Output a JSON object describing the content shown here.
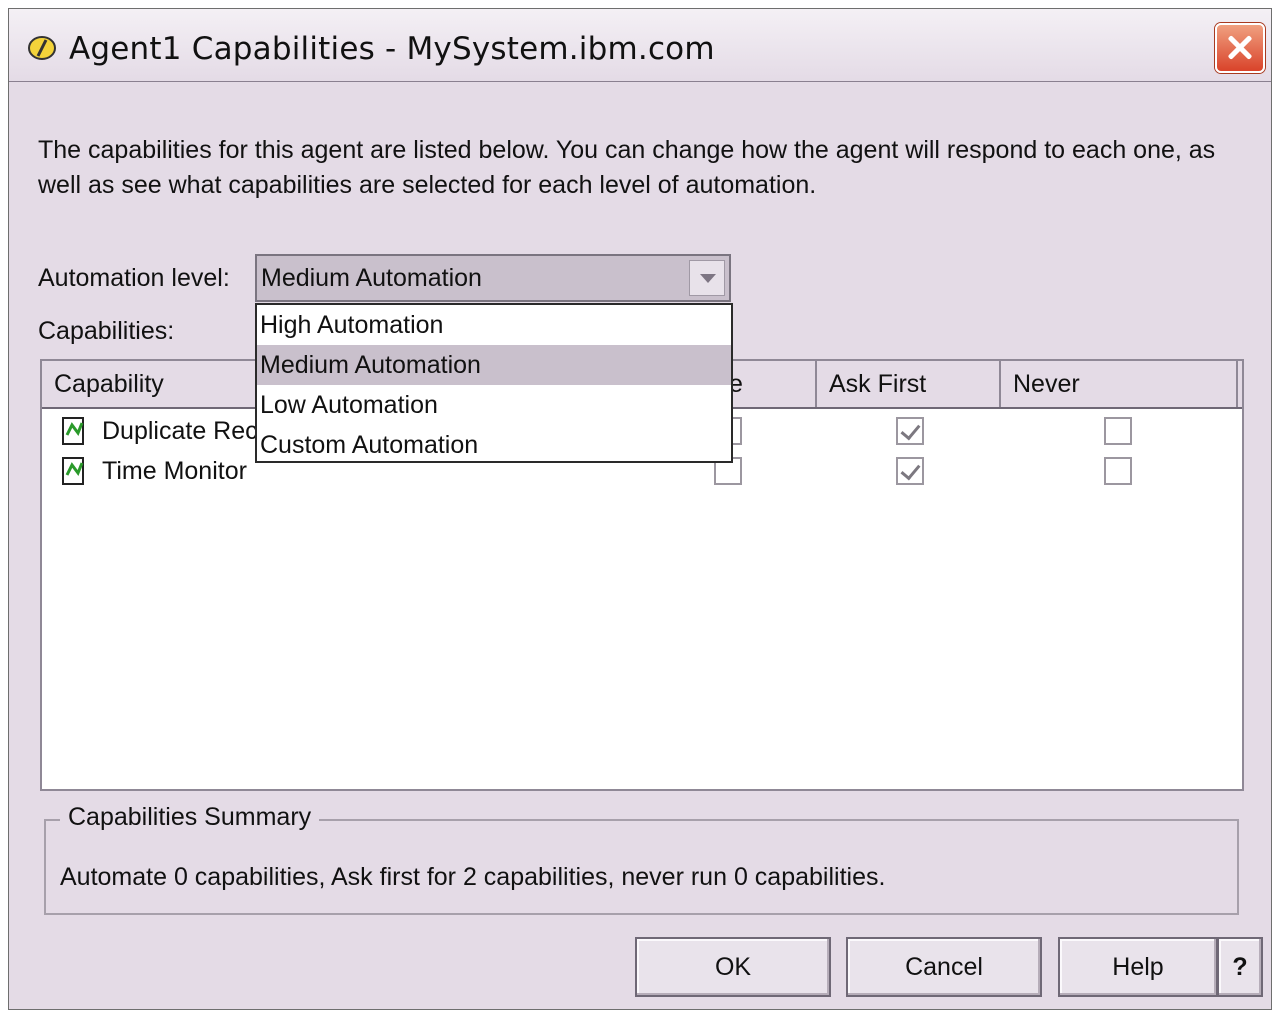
{
  "window": {
    "title": "Agent1 Capabilities - MySystem.ibm.com"
  },
  "description": "The capabilities for this agent are listed below.  You can change how the agent will respond to each one, as well as see what capabilities are selected for each level of automation.",
  "automation": {
    "label": "Automation level:",
    "selected": "Medium Automation",
    "options": [
      "High Automation",
      "Medium Automation",
      "Low Automation",
      "Custom Automation"
    ]
  },
  "capabilities_label": "Capabilities:",
  "table": {
    "columns": [
      "Capability",
      "te",
      "Ask First",
      "Never"
    ],
    "rows": [
      {
        "name": "Duplicate Rec",
        "automate": false,
        "ask_first": true,
        "never": false
      },
      {
        "name": "Time Monitor",
        "automate": false,
        "ask_first": true,
        "never": false
      }
    ]
  },
  "summary": {
    "title": "Capabilities Summary",
    "text": "Automate 0 capabilities, Ask first for 2 capabilities, never run 0 capabilities."
  },
  "buttons": {
    "ok": "OK",
    "cancel": "Cancel",
    "help": "Help",
    "question": "?"
  },
  "colors": {
    "background": "#e4dbe6",
    "selection": "#c9c0cc"
  }
}
